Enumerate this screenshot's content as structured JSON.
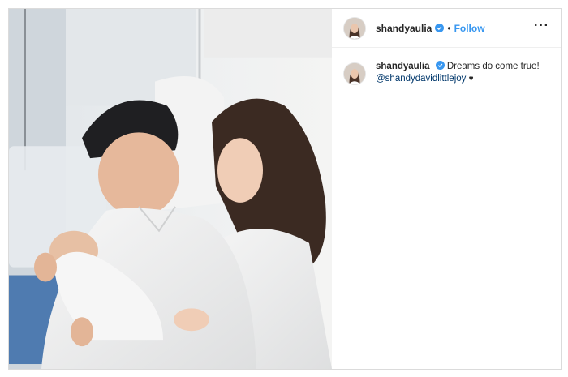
{
  "post": {
    "username": "shandyaulia",
    "verified": true,
    "separator": "•",
    "follow_label": "Follow",
    "more_label": "···"
  },
  "caption": {
    "username": "shandyaulia",
    "text": "Dreams do come true!",
    "mention": "@shandydavidlittlejoy",
    "emoji": "♥"
  },
  "colors": {
    "accent": "#3897f0",
    "mention": "#00376b",
    "border": "#dbdbdb"
  },
  "icons": {
    "verified": "verified-badge-icon",
    "more": "more-options-icon"
  }
}
